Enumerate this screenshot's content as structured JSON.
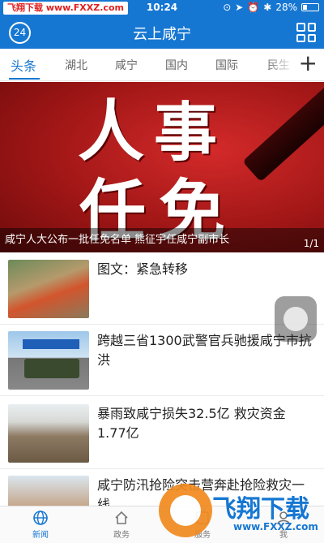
{
  "status_bar": {
    "watermark": "飞翔下载 www.FXXZ.com",
    "time": "10:24",
    "battery": "28%"
  },
  "header": {
    "badge": "24",
    "title": "云上咸宁"
  },
  "tabs": [
    {
      "label": "头条",
      "active": true
    },
    {
      "label": "湖北"
    },
    {
      "label": "咸宁"
    },
    {
      "label": "国内"
    },
    {
      "label": "国际"
    },
    {
      "label": "民生"
    }
  ],
  "banner": {
    "chars": [
      "人",
      "事",
      "任",
      "免"
    ],
    "caption": "咸宁人大公布一批任免名单 熊征宇任咸宁副市长",
    "pager": "1/1"
  },
  "news": [
    {
      "title": "图文：紧急转移"
    },
    {
      "title": "跨越三省1300武警官兵驰援咸宁市抗洪"
    },
    {
      "title": "暴雨致咸宁损失32.5亿 救灾资金1.77亿"
    },
    {
      "title": "咸宁防汛抢险突击营奔赴抢险救灾一线"
    }
  ],
  "bottom_nav": [
    {
      "label": "新闻",
      "icon": "globe-icon",
      "active": true
    },
    {
      "label": "政务",
      "icon": "home-icon"
    },
    {
      "label": "服务",
      "icon": "service-icon"
    },
    {
      "label": "我",
      "icon": "user-icon"
    }
  ],
  "site_watermark": {
    "brand": "飞翔下载",
    "url": "www.FXXZ.com"
  },
  "colors": {
    "primary": "#1677d2",
    "banner_red": "#a01616"
  }
}
